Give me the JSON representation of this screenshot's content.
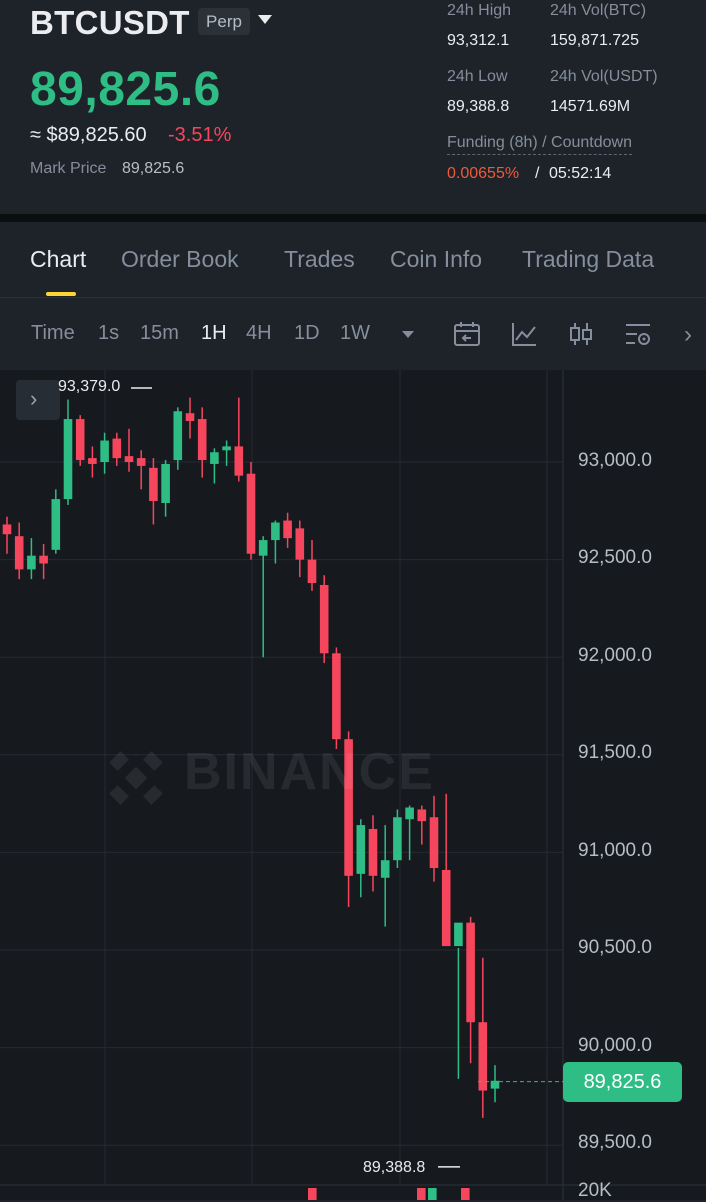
{
  "header": {
    "symbol": "BTCUSDT",
    "contract_type": "Perp",
    "last_price": "89,825.6",
    "fiat_price": "≈ $89,825.60",
    "change_pct": "-3.51%",
    "mark_price_label": "Mark Price",
    "mark_price_value": "89,825.6",
    "stats": {
      "high_label": "24h High",
      "high_value": "93,312.1",
      "vol_btc_label": "24h Vol(BTC)",
      "vol_btc_value": "159,871.725",
      "low_label": "24h Low",
      "low_value": "89,388.8",
      "vol_usdt_label": "24h Vol(USDT)",
      "vol_usdt_value": "14571.69M"
    },
    "funding_label": "Funding (8h) / Countdown",
    "funding_rate": "0.00655%",
    "funding_separator": "/",
    "countdown": "05:52:14"
  },
  "tabs": [
    "Chart",
    "Order Book",
    "Trades",
    "Coin Info",
    "Trading Data"
  ],
  "active_tab": "Chart",
  "toolbar": {
    "time_label": "Time",
    "intervals": [
      "1s",
      "15m",
      "1H",
      "4H",
      "1D",
      "1W"
    ],
    "active_interval": "1H",
    "icons": [
      "calendar-icon",
      "indicator-icon",
      "candle-type-icon",
      "settings-icon",
      "chevron-right-icon"
    ]
  },
  "chart": {
    "watermark": "BINANCE",
    "high_marker": "93,379.0",
    "low_marker": "89,388.8",
    "current_price_tag": "89,825.6",
    "axis_labels": [
      "93,000.0",
      "92,500.0",
      "92,000.0",
      "91,500.0",
      "91,000.0",
      "90,500.0",
      "90,000.0",
      "89,500.0",
      "20K"
    ],
    "expand_icon": "chevron-right-icon"
  },
  "chart_data": {
    "type": "candlestick",
    "interval": "1H",
    "colors": {
      "up": "#2ebd85",
      "down": "#f6465d"
    },
    "y_ticks": [
      93000,
      92500,
      92000,
      91500,
      91000,
      90500,
      90000,
      89500
    ],
    "high_marker": 93379.0,
    "low_marker": 89388.8,
    "last_price": 89825.6,
    "candles": [
      {
        "o": 92680,
        "h": 92720,
        "l": 92530,
        "c": 92630
      },
      {
        "o": 92620,
        "h": 92690,
        "l": 92400,
        "c": 92450
      },
      {
        "o": 92450,
        "h": 92610,
        "l": 92400,
        "c": 92520
      },
      {
        "o": 92520,
        "h": 92580,
        "l": 92400,
        "c": 92480
      },
      {
        "o": 92550,
        "h": 92860,
        "l": 92530,
        "c": 92810
      },
      {
        "o": 92810,
        "h": 93320,
        "l": 92780,
        "c": 93220
      },
      {
        "o": 93220,
        "h": 93240,
        "l": 92980,
        "c": 93010
      },
      {
        "o": 93020,
        "h": 93080,
        "l": 92920,
        "c": 92990
      },
      {
        "o": 93000,
        "h": 93150,
        "l": 92940,
        "c": 93110
      },
      {
        "o": 93120,
        "h": 93150,
        "l": 92980,
        "c": 93020
      },
      {
        "o": 93030,
        "h": 93170,
        "l": 92950,
        "c": 93000
      },
      {
        "o": 93020,
        "h": 93060,
        "l": 92860,
        "c": 92980
      },
      {
        "o": 92970,
        "h": 93020,
        "l": 92680,
        "c": 92800
      },
      {
        "o": 92790,
        "h": 93010,
        "l": 92720,
        "c": 92990
      },
      {
        "o": 93010,
        "h": 93280,
        "l": 92960,
        "c": 93260
      },
      {
        "o": 93250,
        "h": 93330,
        "l": 93120,
        "c": 93210
      },
      {
        "o": 93220,
        "h": 93280,
        "l": 92920,
        "c": 93010
      },
      {
        "o": 92990,
        "h": 93070,
        "l": 92890,
        "c": 93050
      },
      {
        "o": 93060,
        "h": 93110,
        "l": 92980,
        "c": 93080
      },
      {
        "o": 93080,
        "h": 93330,
        "l": 92900,
        "c": 92930
      },
      {
        "o": 92940,
        "h": 93000,
        "l": 92500,
        "c": 92530
      },
      {
        "o": 92520,
        "h": 92620,
        "l": 92000,
        "c": 92600
      },
      {
        "o": 92600,
        "h": 92700,
        "l": 92480,
        "c": 92690
      },
      {
        "o": 92700,
        "h": 92740,
        "l": 92560,
        "c": 92610
      },
      {
        "o": 92660,
        "h": 92700,
        "l": 92410,
        "c": 92500
      },
      {
        "o": 92500,
        "h": 92600,
        "l": 92340,
        "c": 92380
      },
      {
        "o": 92370,
        "h": 92420,
        "l": 91970,
        "c": 92020
      },
      {
        "o": 92020,
        "h": 92050,
        "l": 91530,
        "c": 91580
      },
      {
        "o": 91580,
        "h": 91620,
        "l": 90720,
        "c": 90880
      },
      {
        "o": 90890,
        "h": 91170,
        "l": 90770,
        "c": 91140
      },
      {
        "o": 91120,
        "h": 91190,
        "l": 90800,
        "c": 90880
      },
      {
        "o": 90870,
        "h": 91140,
        "l": 90620,
        "c": 90960
      },
      {
        "o": 90960,
        "h": 91220,
        "l": 90920,
        "c": 91180
      },
      {
        "o": 91170,
        "h": 91240,
        "l": 90960,
        "c": 91230
      },
      {
        "o": 91220,
        "h": 91240,
        "l": 91040,
        "c": 91160
      },
      {
        "o": 91180,
        "h": 91290,
        "l": 90850,
        "c": 90920
      },
      {
        "o": 90910,
        "h": 91300,
        "l": 90720,
        "c": 90520
      },
      {
        "o": 90520,
        "h": 90510,
        "l": 89840,
        "c": 90640
      },
      {
        "o": 90640,
        "h": 90670,
        "l": 89920,
        "c": 90130
      },
      {
        "o": 90130,
        "h": 90460,
        "l": 89640,
        "c": 89780
      },
      {
        "o": 89790,
        "h": 89910,
        "l": 89720,
        "c": 89830
      }
    ]
  }
}
